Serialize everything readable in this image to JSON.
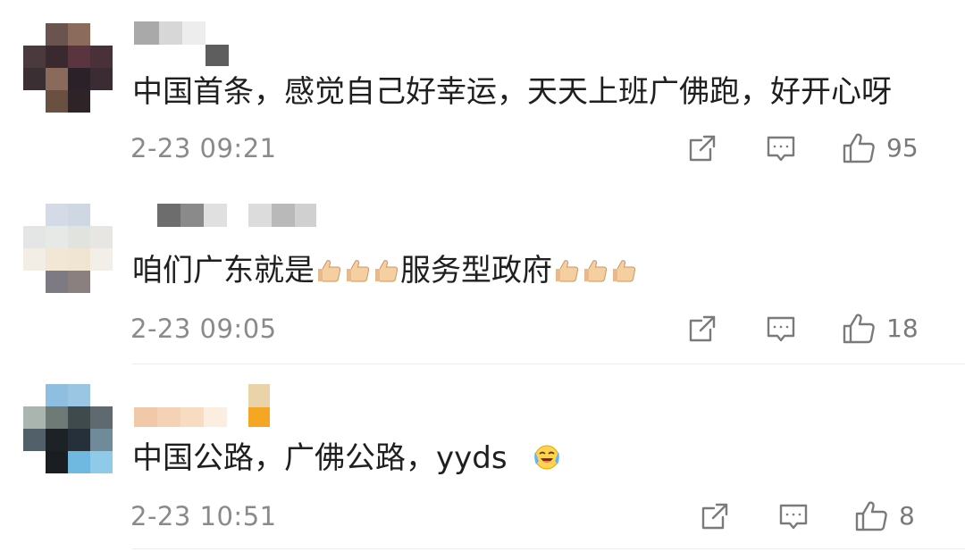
{
  "comments": [
    {
      "text_parts": [
        "中国首条，感觉自己好幸运，天天上班广佛跑，好开心呀"
      ],
      "time": "2-23 09:21",
      "likes": "95"
    },
    {
      "text_parts": [
        "咱们广东就是",
        "服务型政府"
      ],
      "time": "2-23 09:05",
      "likes": "18"
    },
    {
      "text_parts": [
        "中国公路，广佛公路，yyds"
      ],
      "time": "2-23 10:51",
      "likes": "8"
    }
  ],
  "icons": {
    "share": "share-icon",
    "reply": "comment-icon",
    "like": "thumbs-up-icon",
    "emoji_thumbs": "thumbs-up-emoji-icon",
    "emoji_face": "laughing-crying-emoji-icon"
  },
  "colors": {
    "text": "#1f1f1f",
    "meta": "#8a8a8a",
    "icon": "#7a7a7a"
  }
}
